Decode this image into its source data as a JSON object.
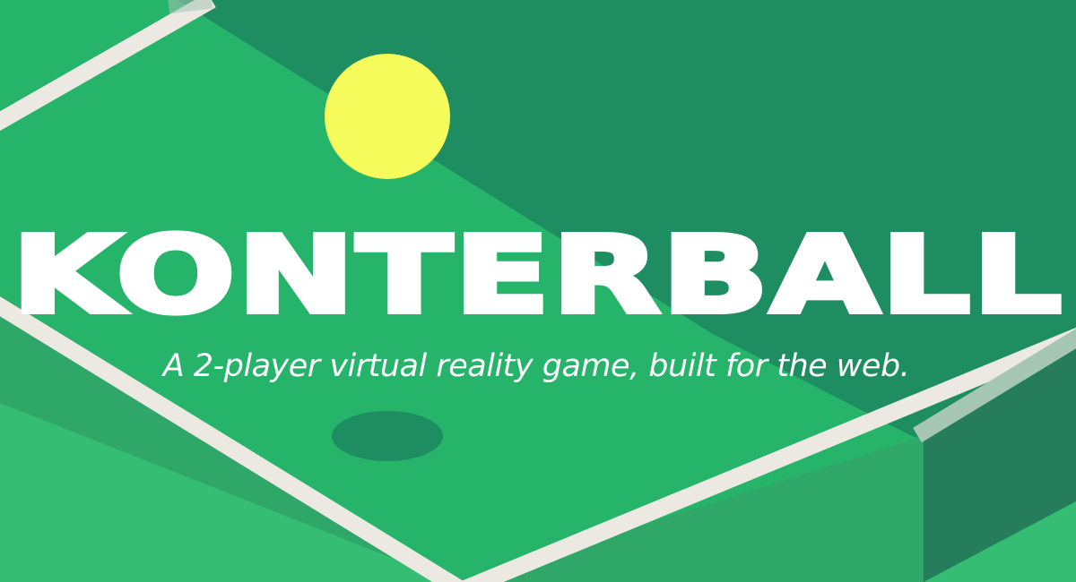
{
  "game": {
    "title": "KONTERBALL",
    "tagline": "A 2-player virtual reality game, built for the web."
  },
  "colors": {
    "background": "#34bd73",
    "table_surface": "#25b46a",
    "table_far_shade": "#1f8d62",
    "table_front_edge": "#2fa768",
    "table_side_edge": "#257d5b",
    "court_line": "#ece9e3",
    "ball": "#f5fb5a",
    "ball_shadow": "#1f8d62",
    "text": "#ffffff"
  }
}
